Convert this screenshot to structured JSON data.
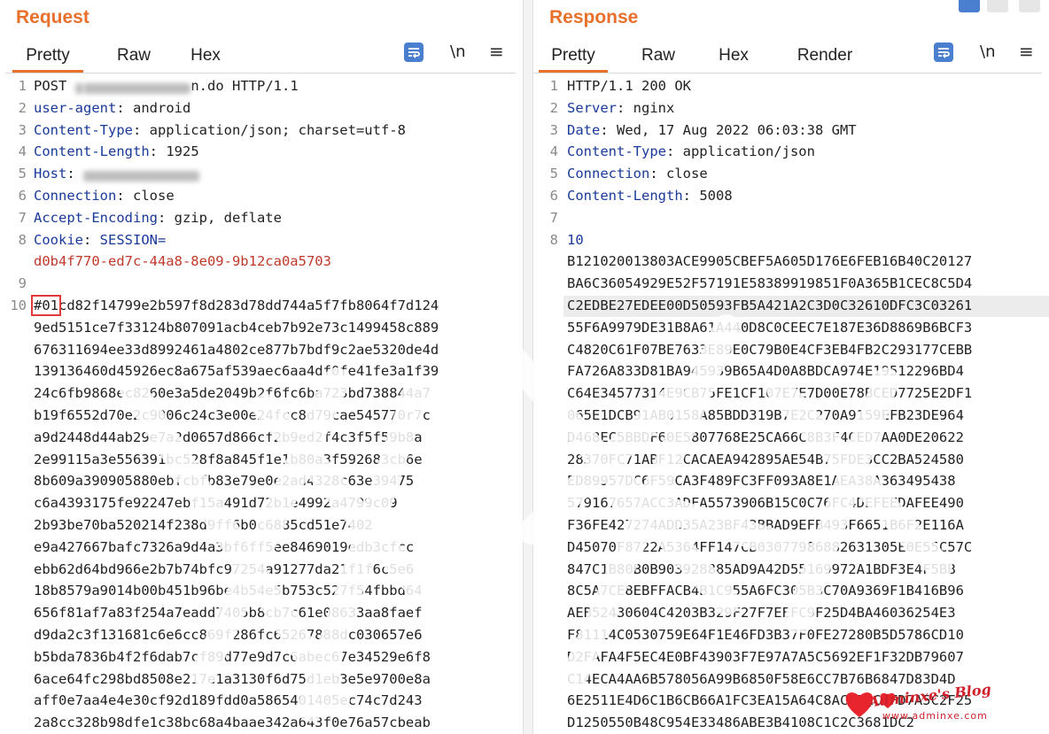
{
  "request": {
    "title": "Request",
    "tabs": [
      "Pretty",
      "Raw",
      "Hex"
    ],
    "active_tab": "Pretty",
    "newline_label": "\\n",
    "menu_label": "≡",
    "lines": [
      {
        "num": "1",
        "segments": [
          {
            "t": "POST "
          },
          {
            "t": "/",
            "blur": true
          },
          {
            "t": "             ",
            "blur": true
          },
          {
            "t": "n.do HTTP/1.1"
          }
        ]
      },
      {
        "num": "2",
        "segments": [
          {
            "t": "user-agent",
            "k": true
          },
          {
            "t": ": android"
          }
        ]
      },
      {
        "num": "3",
        "segments": [
          {
            "t": "Content-Type",
            "k": true
          },
          {
            "t": ": application/json; charset=utf-8"
          }
        ]
      },
      {
        "num": "4",
        "segments": [
          {
            "t": "Content-Length",
            "k": true
          },
          {
            "t": ": 1925"
          }
        ]
      },
      {
        "num": "5",
        "segments": [
          {
            "t": "Host",
            "k": true
          },
          {
            "t": ": "
          },
          {
            "t": "              ",
            "blur": true
          }
        ]
      },
      {
        "num": "6",
        "segments": [
          {
            "t": "Connection",
            "k": true
          },
          {
            "t": ": close"
          }
        ]
      },
      {
        "num": "7",
        "segments": [
          {
            "t": "Accept-Encoding",
            "k": true
          },
          {
            "t": ": gzip, deflate"
          }
        ]
      },
      {
        "num": "8",
        "segments": [
          {
            "t": "Cookie",
            "k": true
          },
          {
            "t": ": "
          },
          {
            "t": "SESSION=",
            "blue": true
          }
        ]
      },
      {
        "num": "",
        "segments": [
          {
            "t": "d0b4f770-ed7c-44a8-8e09-9b12ca0a5703",
            "red": true
          }
        ]
      },
      {
        "num": "9",
        "segments": []
      },
      {
        "num": "10",
        "segments": [
          {
            "t": "#01",
            "box": true
          },
          {
            "t": "cd82f14799e2b597f8d283d78dd744a5f7fb8064f7d124"
          }
        ]
      },
      {
        "num": "",
        "segments": [
          {
            "t": "9ed5151ce7f33124b807091acb4ceb7b92e73c1499458c889"
          }
        ]
      },
      {
        "num": "",
        "segments": [
          {
            "t": "676311694ee33d8992461a4802ce877b7bdf9c2ae5320de4d"
          }
        ]
      },
      {
        "num": "",
        "segments": [
          {
            "t": "139136460d45926ec8a675af539aec6aa4df0fe41fe3a1f39"
          }
        ]
      },
      {
        "num": "",
        "segments": [
          {
            "t": "24c6fb9868ec8260e3a5de2049b2f6fc6ba723bd738844a7"
          }
        ]
      },
      {
        "num": "",
        "segments": [
          {
            "t": "b19f6552d70e2c9006c24c3e00e24fcc8d79cae545770r7c"
          }
        ]
      },
      {
        "num": "",
        "segments": [
          {
            "t": "a9d2448d44ab29e7a2d0657d866cf2b9ed2f4c3f5f59b8a"
          }
        ]
      },
      {
        "num": "",
        "segments": [
          {
            "t": "2e99115a3e556391bc528f8a845f1e1b80a3f592683cb6e"
          }
        ]
      },
      {
        "num": "",
        "segments": [
          {
            "t": "8b609a390905880ebfcbfb83e79e0e2ad4328c63e39475"
          }
        ]
      },
      {
        "num": "",
        "segments": [
          {
            "t": "c6a4393175fe92247ebf15a491d72b1e4992a4799c09"
          }
        ]
      },
      {
        "num": "",
        "segments": [
          {
            "t": "2b93be70ba520214f238d9ff6b0c6885cd51e7402"
          }
        ]
      },
      {
        "num": "",
        "segments": [
          {
            "t": "e9a427667bafc7326a9d4a3bf6ff5ee8469019edb3cfcc"
          }
        ]
      },
      {
        "num": "",
        "segments": [
          {
            "t": "ebb62d64bd966e2b7b74bfc97254a91277da21f1f6c5e6"
          }
        ]
      },
      {
        "num": "",
        "segments": [
          {
            "t": "18b8579a9014b00b451b96be4b54e5b753c527f54fbbd64"
          }
        ]
      },
      {
        "num": "",
        "segments": [
          {
            "t": "656f81af7a83f254a7eadd7405b8cb7c61e08633aa8faef"
          }
        ]
      },
      {
        "num": "",
        "segments": [
          {
            "t": "d9da2c3f131681c6e6cc869f286fc65267888dc030657e6"
          }
        ]
      },
      {
        "num": "",
        "segments": [
          {
            "t": "b5bda7836b4f2f6dab7cf89d77e9d7c6abec67e34529e6f8"
          }
        ]
      },
      {
        "num": "",
        "segments": [
          {
            "t": "6ace64fc298bd8508e217e1a3130f6d75d1eb3e5e9700e8a"
          }
        ]
      },
      {
        "num": "",
        "segments": [
          {
            "t": "aff0e7aa4e4e30cf92d189fdd0a5865401405ec74c7d243"
          }
        ]
      },
      {
        "num": "",
        "segments": [
          {
            "t": "2a8cc328b98dfe1c38bc68a4baae342a643f0e76a57cbeab"
          }
        ]
      }
    ]
  },
  "response": {
    "title": "Response",
    "tabs": [
      "Pretty",
      "Raw",
      "Hex",
      "Render"
    ],
    "active_tab": "Pretty",
    "newline_label": "\\n",
    "menu_label": "≡",
    "lines": [
      {
        "num": "1",
        "segments": [
          {
            "t": "HTTP/1.1 200 OK"
          }
        ]
      },
      {
        "num": "2",
        "segments": [
          {
            "t": "Server",
            "k": true
          },
          {
            "t": ": nginx"
          }
        ]
      },
      {
        "num": "3",
        "segments": [
          {
            "t": "Date",
            "k": true
          },
          {
            "t": ": Wed, 17 Aug 2022 06:03:38 GMT"
          }
        ]
      },
      {
        "num": "4",
        "segments": [
          {
            "t": "Content-Type",
            "k": true
          },
          {
            "t": ": application/json"
          }
        ]
      },
      {
        "num": "5",
        "segments": [
          {
            "t": "Connection",
            "k": true
          },
          {
            "t": ": close"
          }
        ]
      },
      {
        "num": "6",
        "segments": [
          {
            "t": "Content-Length",
            "k": true
          },
          {
            "t": ": 5008"
          }
        ]
      },
      {
        "num": "7",
        "segments": []
      },
      {
        "num": "8",
        "segments": [
          {
            "t": "10",
            "blue": true
          }
        ]
      },
      {
        "num": "",
        "segments": [
          {
            "t": "B121020013803ACE9905CBEF5A605D176E6FEB16B40C20127"
          }
        ]
      },
      {
        "num": "",
        "segments": [
          {
            "t": "BA6C36054929E52F57191E58389919851F0A365B1CEC8C5D4"
          }
        ]
      },
      {
        "num": "",
        "segments": [
          {
            "t": "C2EDBE27EDEE00D50593FB5A421A2C3D0C32610DFC3C03261"
          }
        ]
      },
      {
        "num": "",
        "segments": [
          {
            "t": "55F6A9979DE31B8A61A440D8C0CEEC7E187E36D8869B6BCF3"
          }
        ]
      },
      {
        "num": "",
        "segments": [
          {
            "t": "C4820C61F07BE7633E89E0C79B0E4CF3EB4FB2C293177CEBB"
          }
        ]
      },
      {
        "num": "",
        "segments": [
          {
            "t": "FA726A833D81BA945939B65A4D0A8BDCA974E19512296BD4"
          }
        ]
      },
      {
        "num": "",
        "segments": [
          {
            "t": "C64E34577314E9CB75FE1CF107E7E7D00E78BCED7725E2DF1"
          }
        ]
      },
      {
        "num": "",
        "segments": [
          {
            "t": "065E1DCB91AB0158A85BDD319B7E2C270A9159EFB23DE964"
          }
        ]
      },
      {
        "num": "",
        "segments": [
          {
            "t": "D468EC5BBDF60E5807768E25CA66C8B3F4CED7AA0DE20622"
          }
        ]
      },
      {
        "num": "",
        "segments": [
          {
            "t": "28370FC71ABF12CACAEA942895AE54B75FDE3CC2BA524580"
          }
        ]
      },
      {
        "num": "",
        "segments": [
          {
            "t": "ED89957DC6F59CA3F489FC3FF093A8E1AEA38A363495438"
          }
        ]
      },
      {
        "num": "",
        "segments": [
          {
            "t": "579167657ACC3ADFA5573906B15C0C76FC4DEFEEDAFEE490"
          }
        ]
      },
      {
        "num": "",
        "segments": [
          {
            "t": "F36FE427274ADD35A23BF43BBAD9EFB493F6651B6F2E116A"
          }
        ]
      },
      {
        "num": "",
        "segments": [
          {
            "t": "D45070F8722A5364FF147CB03077986882631305E0E55C57C"
          }
        ]
      },
      {
        "num": "",
        "segments": [
          {
            "t": "847C1B80B0B903928885AD9A42D55169972A1BDF3E4F5BB"
          }
        ]
      },
      {
        "num": "",
        "segments": [
          {
            "t": "8C5A7CE8EBFFACB4B1C955A6FC305B3C70A9369F1B416B96"
          }
        ]
      },
      {
        "num": "",
        "segments": [
          {
            "t": "AEB52430604C4203B329F27F7EEFC9F25D4BA46036254E3"
          }
        ]
      },
      {
        "num": "",
        "segments": [
          {
            "t": "F81114C0530759E64F1E46FD3B37F0FE27280B5D5786CD10"
          }
        ]
      },
      {
        "num": "",
        "segments": [
          {
            "t": "D2FAFA4F5EC4E0BF43903F7E97A7A5C5692EF1F32DB79607"
          }
        ]
      },
      {
        "num": "",
        "segments": [
          {
            "t": "C14ECA4AA6B578056A99B6850F58E6CC7B76B6847D83D4D"
          }
        ]
      },
      {
        "num": "",
        "segments": [
          {
            "t": "6E2511E4D6C1B6CB66A1FC3EA15A64C8AC77AC8FD7A5C2F25"
          }
        ]
      },
      {
        "num": "",
        "segments": [
          {
            "t": "D1250550B48C954E33486ABE3B4108C1C2C3681DC2"
          }
        ]
      }
    ],
    "highlight_line_index": 10
  },
  "watermark_text": "Adminxe's Blog",
  "watermark_sub": "www.adminxe.com",
  "colors": {
    "accent": "#e8702a",
    "keyword": "#1a3a9a",
    "cookie_value": "#c0392b",
    "tool_blue": "#4a7fd0"
  }
}
